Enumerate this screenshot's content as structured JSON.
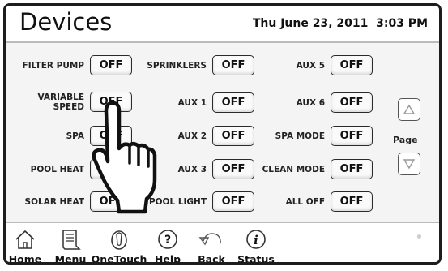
{
  "header": {
    "title": "Devices",
    "date": "Thu June 23, 2011",
    "time": "3:03 PM"
  },
  "devices": [
    {
      "label": "FILTER PUMP",
      "value": "OFF"
    },
    {
      "label": "VARIABLE SPEED",
      "value": "OFF"
    },
    {
      "label": "SPA",
      "value": "OFF"
    },
    {
      "label": "POOL HEAT",
      "value": "OFF"
    },
    {
      "label": "SOLAR HEAT",
      "value": "OFF"
    },
    {
      "label": "SPRINKLERS",
      "value": "OFF"
    },
    {
      "label": "AUX 1",
      "value": "OFF"
    },
    {
      "label": "AUX 2",
      "value": "OFF"
    },
    {
      "label": "AUX 3",
      "value": "OFF"
    },
    {
      "label": "POOL LIGHT",
      "value": "OFF"
    },
    {
      "label": "AUX 5",
      "value": "OFF"
    },
    {
      "label": "AUX 6",
      "value": "OFF"
    },
    {
      "label": "SPA MODE",
      "value": "OFF"
    },
    {
      "label": "CLEAN MODE",
      "value": "OFF"
    },
    {
      "label": "ALL OFF",
      "value": "OFF"
    }
  ],
  "page": {
    "label": "Page",
    "up_icon": "triangle-up-icon",
    "down_icon": "triangle-down-icon"
  },
  "nav": [
    {
      "label": "Home",
      "icon": "home-icon"
    },
    {
      "label": "Menu",
      "icon": "menu-icon"
    },
    {
      "label": "OneTouch",
      "icon": "onetouch-icon"
    },
    {
      "label": "Help",
      "icon": "help-icon"
    },
    {
      "label": "Back",
      "icon": "back-icon"
    },
    {
      "label": "Status",
      "icon": "status-icon"
    }
  ],
  "overlay": {
    "icon": "pointing-hand-icon"
  }
}
